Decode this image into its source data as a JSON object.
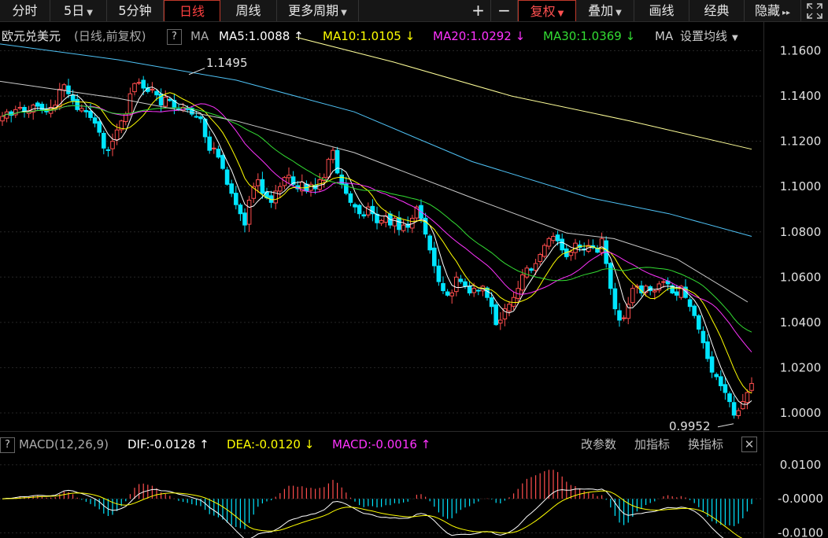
{
  "toolbar": {
    "items": [
      "分时",
      "5日",
      "5分钟",
      "日线",
      "周线",
      "更多周期"
    ],
    "right_items": [
      "+",
      "−",
      "复权",
      "叠加",
      "画线",
      "经典",
      "隐藏"
    ]
  },
  "legend": {
    "title": "欧元兑美元",
    "subtitle": "(日线,前复权)",
    "help": "?",
    "ma_label": "MA",
    "ma5": "MA5:1.0088",
    "ma10": "MA10:1.0105",
    "ma20": "MA20:1.0292",
    "ma30": "MA30:1.0369",
    "ma_more": "MA",
    "settings": "设置均线",
    "up_arrow": "↑",
    "down_arrow": "↓"
  },
  "macd_legend": {
    "help": "?",
    "title": "MACD(12,26,9)",
    "dif": "DIF:-0.0128",
    "dea": "DEA:-0.0120",
    "macd": "MACD:-0.0016",
    "up_arrow": "↑",
    "down_arrow": "↓",
    "btn_params": "改参数",
    "btn_add": "加指标",
    "btn_switch": "换指标",
    "btn_close": "✕"
  },
  "colors": {
    "up": "#ff4d4d",
    "down": "#00e5ff",
    "ma5": "#ffffff",
    "ma10": "#ffff00",
    "ma20": "#ff33ff",
    "ma30": "#33dd33",
    "ma60": "#cccccc",
    "ma120": "#4fc3f7",
    "ma250": "#ffff99"
  },
  "chart_data": [
    {
      "type": "candlestick",
      "series_name": "欧元兑美元",
      "y_ticks": [
        "1.1600",
        "1.1400",
        "1.1200",
        "1.1000",
        "1.0800",
        "1.0600",
        "1.0400",
        "1.0200",
        "1.0000"
      ],
      "ylim": [
        0.992,
        1.172
      ],
      "annotations": [
        {
          "text": "1.1495",
          "value": 1.1495,
          "kind": "high"
        },
        {
          "text": "0.9952",
          "value": 0.9952,
          "kind": "low"
        }
      ],
      "ma_values": {
        "MA5": 1.0088,
        "MA10": 1.0105,
        "MA20": 1.0292,
        "MA30": 1.0369
      },
      "close_path": [
        1.131,
        1.133,
        1.1315,
        1.134,
        1.135,
        1.133,
        1.1335,
        1.136,
        1.1355,
        1.134,
        1.133,
        1.135,
        1.136,
        1.143,
        1.145,
        1.141,
        1.138,
        1.134,
        1.1345,
        1.133,
        1.1305,
        1.128,
        1.124,
        1.117,
        1.116,
        1.12,
        1.125,
        1.129,
        1.132,
        1.141,
        1.1455,
        1.146,
        1.1435,
        1.142,
        1.143,
        1.1405,
        1.136,
        1.1395,
        1.138,
        1.135,
        1.134,
        1.135,
        1.134,
        1.132,
        1.131,
        1.13,
        1.122,
        1.116,
        1.117,
        1.113,
        1.108,
        1.101,
        1.097,
        1.092,
        1.088,
        1.083,
        1.094,
        1.1,
        1.103,
        1.097,
        1.095,
        1.093,
        1.098,
        1.1,
        1.104,
        1.105,
        1.101,
        1.099,
        1.102,
        1.098,
        1.101,
        1.099,
        1.103,
        1.104,
        1.112,
        1.116,
        1.106,
        1.101,
        1.097,
        1.093,
        1.091,
        1.088,
        1.087,
        1.091,
        1.088,
        1.084,
        1.085,
        1.087,
        1.083,
        1.086,
        1.081,
        1.083,
        1.082,
        1.086,
        1.091,
        1.086,
        1.079,
        1.072,
        1.065,
        1.058,
        1.054,
        1.052,
        1.053,
        1.06,
        1.058,
        1.056,
        1.053,
        1.055,
        1.054,
        1.056,
        1.051,
        1.047,
        1.039,
        1.041,
        1.046,
        1.048,
        1.051,
        1.055,
        1.061,
        1.064,
        1.063,
        1.066,
        1.07,
        1.074,
        1.077,
        1.078,
        1.076,
        1.072,
        1.069,
        1.071,
        1.075,
        1.073,
        1.072,
        1.074,
        1.073,
        1.071,
        1.077,
        1.066,
        1.055,
        1.046,
        1.041,
        1.042,
        1.048,
        1.055,
        1.056,
        1.053,
        1.056,
        1.054,
        1.054,
        1.057,
        1.058,
        1.057,
        1.053,
        1.052,
        1.056,
        1.051,
        1.047,
        1.043,
        1.037,
        1.031,
        1.024,
        1.018,
        1.016,
        1.012,
        1.009,
        1.005,
        0.999,
        1.001,
        1.005,
        1.009,
        1.013
      ]
    },
    {
      "type": "macd",
      "params": "12,26,9",
      "y_ticks": [
        "0.0100",
        "-0.0000",
        "-0.0100"
      ],
      "ylim": [
        -0.0115,
        0.0125
      ],
      "DIF": -0.0128,
      "DEA": -0.012,
      "MACD": -0.0016
    }
  ]
}
